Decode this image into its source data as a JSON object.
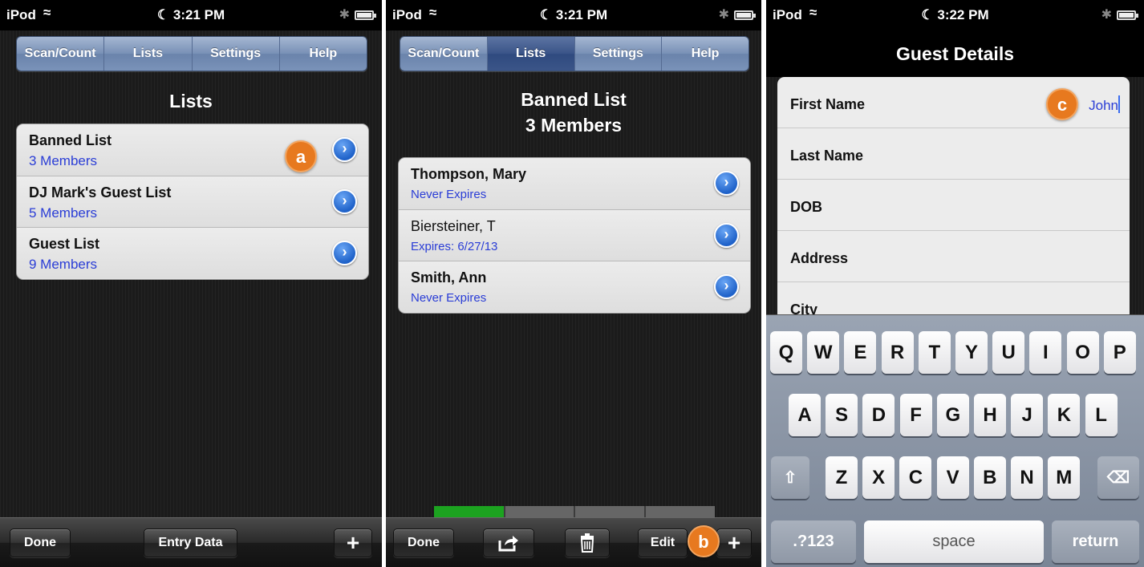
{
  "status": {
    "carrier": "iPod",
    "time1": "3:21 PM",
    "time2": "3:21 PM",
    "time3": "3:22 PM"
  },
  "tabs": [
    "Scan/Count",
    "Lists",
    "Settings",
    "Help"
  ],
  "panel1": {
    "title": "Lists",
    "items": [
      {
        "name": "Banned List",
        "count": "3 Members"
      },
      {
        "name": "DJ Mark's Guest List",
        "count": "5 Members"
      },
      {
        "name": "Guest List",
        "count": "9 Members"
      }
    ],
    "badge": "a",
    "toolbar": {
      "done": "Done",
      "entry": "Entry Data",
      "plus": "+"
    }
  },
  "panel2": {
    "title_line1": "Banned List",
    "title_line2": "3 Members",
    "members": [
      {
        "name": "Thompson, Mary",
        "status": "Never Expires"
      },
      {
        "name": "Biersteiner, T",
        "status": "Expires: 6/27/13"
      },
      {
        "name": "Smith, Ann",
        "status": "Never Expires"
      }
    ],
    "progress": 0.25,
    "badge": "b",
    "toolbar": {
      "done": "Done",
      "edit": "Edit",
      "plus": "+"
    }
  },
  "panel3": {
    "title": "Guest Details",
    "fields": [
      {
        "label": "First Name",
        "value": "John"
      },
      {
        "label": "Last Name",
        "value": ""
      },
      {
        "label": "DOB",
        "value": ""
      },
      {
        "label": "Address",
        "value": ""
      },
      {
        "label": "City",
        "value": ""
      }
    ],
    "badge": "c",
    "keyboard": {
      "row1": [
        "Q",
        "W",
        "E",
        "R",
        "T",
        "Y",
        "U",
        "I",
        "O",
        "P"
      ],
      "row2": [
        "A",
        "S",
        "D",
        "F",
        "G",
        "H",
        "J",
        "K",
        "L"
      ],
      "row3": [
        "Z",
        "X",
        "C",
        "V",
        "B",
        "N",
        "M"
      ],
      "numbers": ".?123",
      "space": "space",
      "return": "return"
    }
  },
  "colors": {
    "accent_blue": "#2a3dd6",
    "badge_orange": "#e7791f",
    "progress_green": "#1ca320"
  }
}
